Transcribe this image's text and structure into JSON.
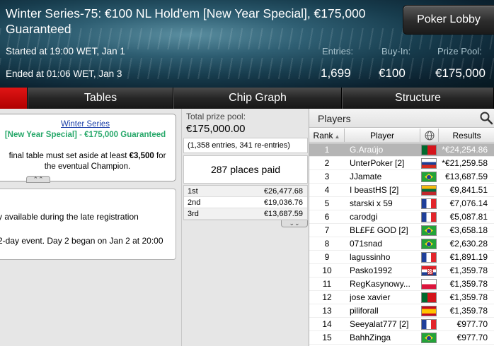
{
  "tournament": {
    "title": "Winter Series-75: €100 NL Hold'em [New Year Special], €175,000 Guaranteed",
    "started": "Started at 19:00 WET, Jan 1",
    "ended": "Ended at 01:06 WET, Jan 3",
    "stats": [
      {
        "label": "Entries:",
        "value": "1,699"
      },
      {
        "label": "Buy-In:",
        "value": "€100"
      },
      {
        "label": "Prize Pool:",
        "value": "€175,000"
      }
    ],
    "lobby_button": "Poker Lobby"
  },
  "tabs": [
    {
      "label": ""
    },
    {
      "label": "Tables"
    },
    {
      "label": "Chip Graph"
    },
    {
      "label": "Structure"
    }
  ],
  "info": {
    "link": "Winter Series",
    "special": "[New Year Special]",
    "separator": " - ",
    "guarantee": "€175,000 Guaranteed",
    "text_prefix": "final table must set aside at least ",
    "text_amount": "€3,500",
    "text_suffix": " for the eventual Champion.",
    "note1": "y available during the late registration",
    "note2": "2-day event. Day 2 began on Jan 2 at 20:00"
  },
  "prize": {
    "label": "Total prize pool:",
    "value": "€175,000.00",
    "entries": "(1,358 entries, 341 re-entries)",
    "places_paid": "287 places paid",
    "payouts": [
      {
        "place": "1st",
        "amount": "€26,477.68"
      },
      {
        "place": "2nd",
        "amount": "€19,036.76"
      },
      {
        "place": "3rd",
        "amount": "€13,687.59"
      }
    ]
  },
  "players": {
    "title": "Players",
    "columns": {
      "rank": "Rank",
      "player": "Player",
      "results": "Results"
    },
    "rows": [
      {
        "rank": "1",
        "name": "G.Araújo",
        "flag": "pt",
        "result": "*€24,254.86"
      },
      {
        "rank": "2",
        "name": "UnterPoker [2]",
        "flag": "ru",
        "result": "*€21,259.58"
      },
      {
        "rank": "3",
        "name": "JJamate",
        "flag": "br",
        "result": "€13,687.59"
      },
      {
        "rank": "4",
        "name": "I beastHS [2]",
        "flag": "lt",
        "result": "€9,841.51"
      },
      {
        "rank": "5",
        "name": "starski x 59",
        "flag": "fr",
        "result": "€7,076.14"
      },
      {
        "rank": "6",
        "name": "carodgi",
        "flag": "fr",
        "result": "€5,087.81"
      },
      {
        "rank": "7",
        "name": "BL£F£ GOD [2]",
        "flag": "br",
        "result": "€3,658.18"
      },
      {
        "rank": "8",
        "name": "071snad",
        "flag": "br",
        "result": "€2,630.28"
      },
      {
        "rank": "9",
        "name": "lagussinho",
        "flag": "fr",
        "result": "€1,891.19"
      },
      {
        "rank": "10",
        "name": "Pasko1992",
        "flag": "hr",
        "result": "€1,359.78"
      },
      {
        "rank": "11",
        "name": "RegKasynowy...",
        "flag": "pl",
        "result": "€1,359.78"
      },
      {
        "rank": "12",
        "name": "jose xavier",
        "flag": "pt",
        "result": "€1,359.78"
      },
      {
        "rank": "13",
        "name": "piliforall",
        "flag": "es",
        "result": "€1,359.78"
      },
      {
        "rank": "14",
        "name": "Seeyalat777 [2]",
        "flag": "fr",
        "result": "€977.70"
      },
      {
        "rank": "15",
        "name": "BahhZinga",
        "flag": "br",
        "result": "€977.70"
      }
    ]
  },
  "colors": {
    "accent_tab": "#c00000",
    "special_text": "#27a86a",
    "link": "#1a3ea8"
  }
}
